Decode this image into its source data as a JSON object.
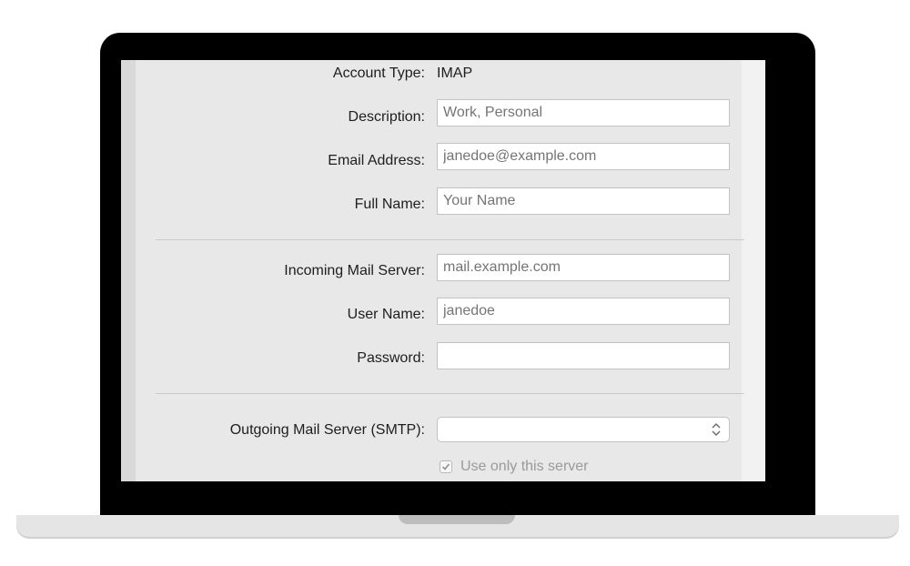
{
  "form": {
    "account_type_label": "Account Type:",
    "account_type_value": "IMAP",
    "description_label": "Description:",
    "description_placeholder": "Work, Personal",
    "email_label": "Email Address:",
    "email_placeholder": "janedoe@example.com",
    "full_name_label": "Full Name:",
    "full_name_placeholder": "Your Name",
    "incoming_label": "Incoming Mail Server:",
    "incoming_placeholder": "mail.example.com",
    "username_label": "User Name:",
    "username_placeholder": "janedoe",
    "password_label": "Password:",
    "password_placeholder": "",
    "outgoing_label": "Outgoing Mail Server (SMTP):",
    "outgoing_value": "",
    "use_only_label": "Use only this server",
    "use_only_checked": true
  },
  "colors": {
    "lid": "#000000",
    "pane": "#e8e8e8",
    "base": "#e5e5e5"
  }
}
